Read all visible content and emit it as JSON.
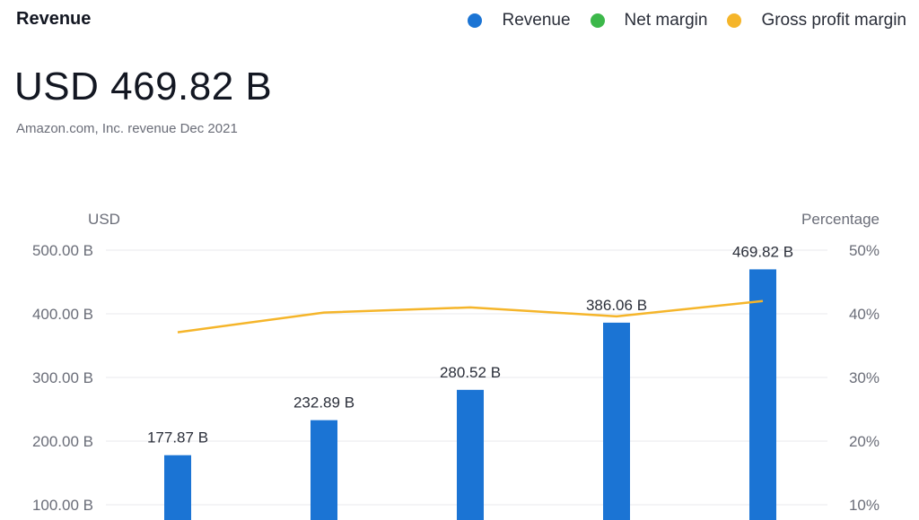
{
  "header": {
    "title": "Revenue",
    "value": "USD 469.82 B",
    "subtitle": "Amazon.com, Inc. revenue Dec 2021"
  },
  "legend": [
    {
      "label": "Revenue",
      "color": "#1b74d4"
    },
    {
      "label": "Net margin",
      "color": "#3cb84a"
    },
    {
      "label": "Gross profit margin",
      "color": "#f5b52a"
    }
  ],
  "chart_data": {
    "type": "bar",
    "left_axis_title": "USD",
    "right_axis_title": "Percentage",
    "left_ticks": [
      "500.00 B",
      "400.00 B",
      "300.00 B",
      "200.00 B",
      "100.00 B"
    ],
    "right_ticks": [
      "50%",
      "40%",
      "30%",
      "20%",
      "10%"
    ],
    "left_ylim": [
      0,
      500
    ],
    "right_ylim": [
      0,
      50
    ],
    "grid": true,
    "series": [
      {
        "name": "Revenue",
        "type": "bar",
        "axis": "left",
        "color": "#1b74d4",
        "values": [
          177.87,
          232.89,
          280.52,
          386.06,
          469.82
        ],
        "labels": [
          "177.87 B",
          "232.89 B",
          "280.52 B",
          "386.06 B",
          "469.82 B"
        ]
      },
      {
        "name": "Gross profit margin",
        "type": "line",
        "axis": "right",
        "color": "#f5b52a",
        "values": [
          37.1,
          40.2,
          41.0,
          39.6,
          42.0
        ]
      }
    ]
  }
}
